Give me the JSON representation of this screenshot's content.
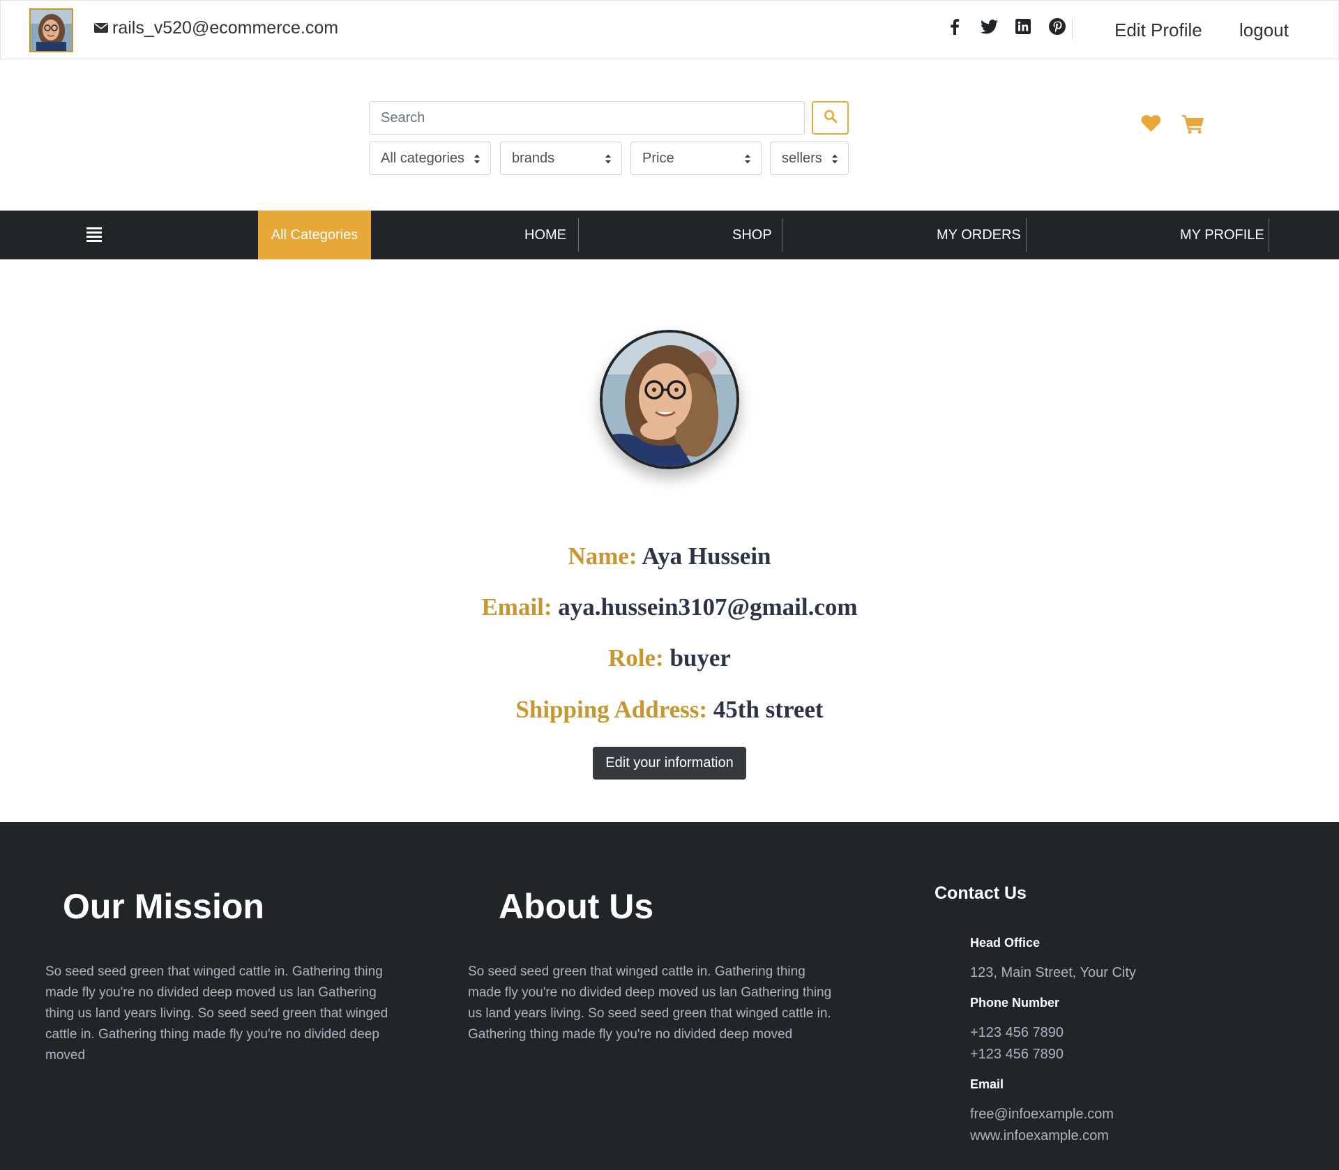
{
  "header": {
    "user_email": "rails_v520@ecommerce.com",
    "edit_profile": "Edit Profile",
    "logout": "logout",
    "social": [
      "facebook-icon",
      "twitter-icon",
      "linkedin-icon",
      "pinterest-icon"
    ]
  },
  "search": {
    "placeholder": "Search",
    "filters": {
      "categories": "All categories",
      "brands": "brands",
      "price": "Price",
      "sellers": "sellers"
    }
  },
  "nav": {
    "all_categories": "All Categories",
    "items": [
      "HOME",
      "SHOP",
      "MY ORDERS",
      "MY PROFILE"
    ]
  },
  "profile": {
    "name_label": "Name:",
    "name": "Aya Hussein",
    "email_label": "Email:",
    "email": "aya.hussein3107@gmail.com",
    "role_label": "Role:",
    "role": "buyer",
    "address_label": "Shipping Address:",
    "address": "45th street",
    "edit_button": "Edit your information"
  },
  "footer": {
    "mission_title": "Our Mission",
    "mission_text": "So seed seed green that winged cattle in. Gathering thing made fly you're no divided deep moved us lan Gathering thing us land years living. So seed seed green that winged cattle in. Gathering thing made fly you're no divided deep moved",
    "about_title": "About Us",
    "about_text": "So seed seed green that winged cattle in. Gathering thing made fly you're no divided deep moved us lan Gathering thing us land years living. So seed seed green that winged cattle in. Gathering thing made fly you're no divided deep moved",
    "contact_title": "Contact Us",
    "head_office_label": "Head Office",
    "head_office": "123, Main Street, Your City",
    "phone_label": "Phone Number",
    "phone_1": "+123 456 7890",
    "phone_2": "+123 456 7890",
    "email_label": "Email",
    "email": "free@infoexample.com",
    "website": "www.infoexample.com"
  },
  "colors": {
    "accent": "#e8a838",
    "label_gold": "#c8962e",
    "dark": "#212529",
    "value_navy": "#2b3447"
  }
}
